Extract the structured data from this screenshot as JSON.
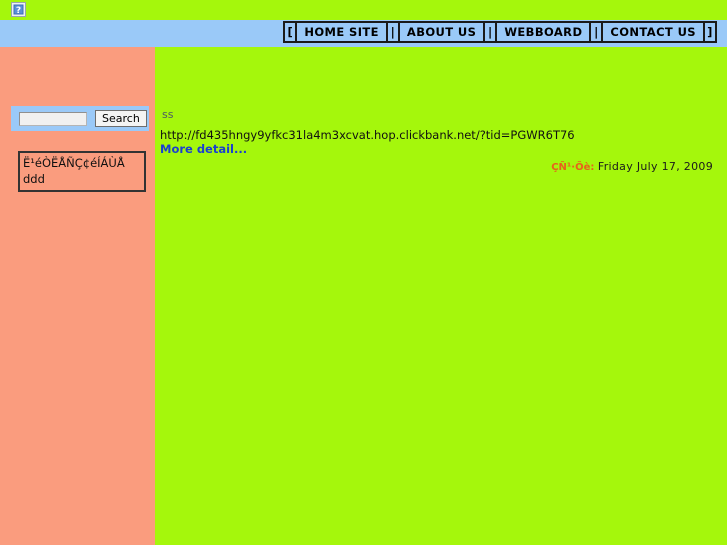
{
  "page": {
    "background_color": "#a5f70c",
    "sidebar_color": "#fa9c7e",
    "nav_color": "#9ac9f8"
  },
  "topbar": {
    "broken_image_icon": "broken-image-icon",
    "broken_image_alt": "?"
  },
  "nav": {
    "open_bracket": "[",
    "close_bracket": "]",
    "separator": "|",
    "items": [
      {
        "label": "HOME SITE"
      },
      {
        "label": "ABOUT US"
      },
      {
        "label": "WEBBOARD"
      },
      {
        "label": "CONTACT US"
      }
    ]
  },
  "sidebar": {
    "search": {
      "input_value": "",
      "placeholder": "",
      "button_label": "Search"
    },
    "info_box": {
      "lines": [
        "Ë¹éÒËÅÑÇ¢éÍÁÙÅ",
        "ddd"
      ]
    }
  },
  "main": {
    "post": {
      "title": "ss",
      "url": "http://fd435hngy9yfkc31la4m3xcvat.hop.clickbank.net/?tid=PGWR6T76",
      "more_detail_label": "More detail..."
    },
    "date": {
      "label": "ÇÑ¹·Õè:",
      "value": "Friday July 17, 2009",
      "label_color": "#e8601c"
    }
  }
}
